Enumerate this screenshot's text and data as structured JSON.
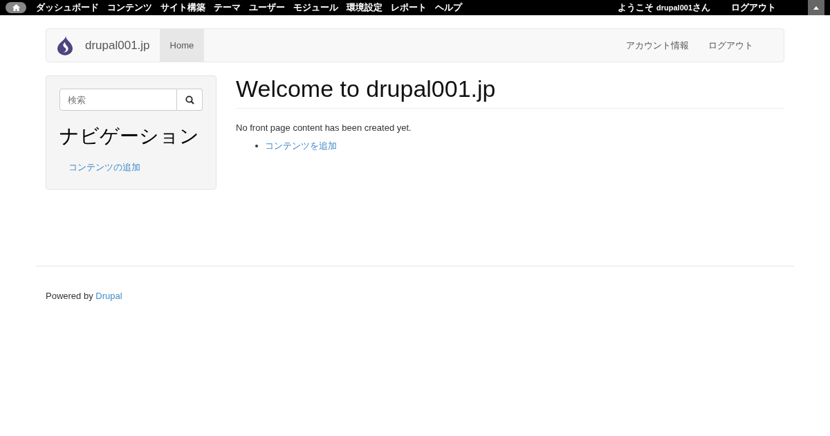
{
  "admin_bar": {
    "menu": [
      "ダッシュボード",
      "コンテンツ",
      "サイト構築",
      "テーマ",
      "ユーザー",
      "モジュール",
      "環境設定",
      "レポート",
      "ヘルプ"
    ],
    "welcome": "ようこそ **drupal001**さん",
    "logout": "ログアウト"
  },
  "navbar": {
    "site_name": "drupal001.jp",
    "tabs": [
      {
        "label": "Home",
        "selected": true
      }
    ],
    "right_links": [
      "アカウント情報",
      "ログアウト"
    ]
  },
  "sidebar": {
    "search": {
      "placeholder": "検索"
    },
    "title": "ナビゲーション",
    "links": [
      "コンテンツの追加"
    ]
  },
  "main": {
    "title": "Welcome to drupal001.jp",
    "message": "No front page content has been created yet.",
    "links": [
      "コンテンツを追加"
    ]
  },
  "footer": {
    "text": "Powered by ",
    "link": "Drupal"
  }
}
